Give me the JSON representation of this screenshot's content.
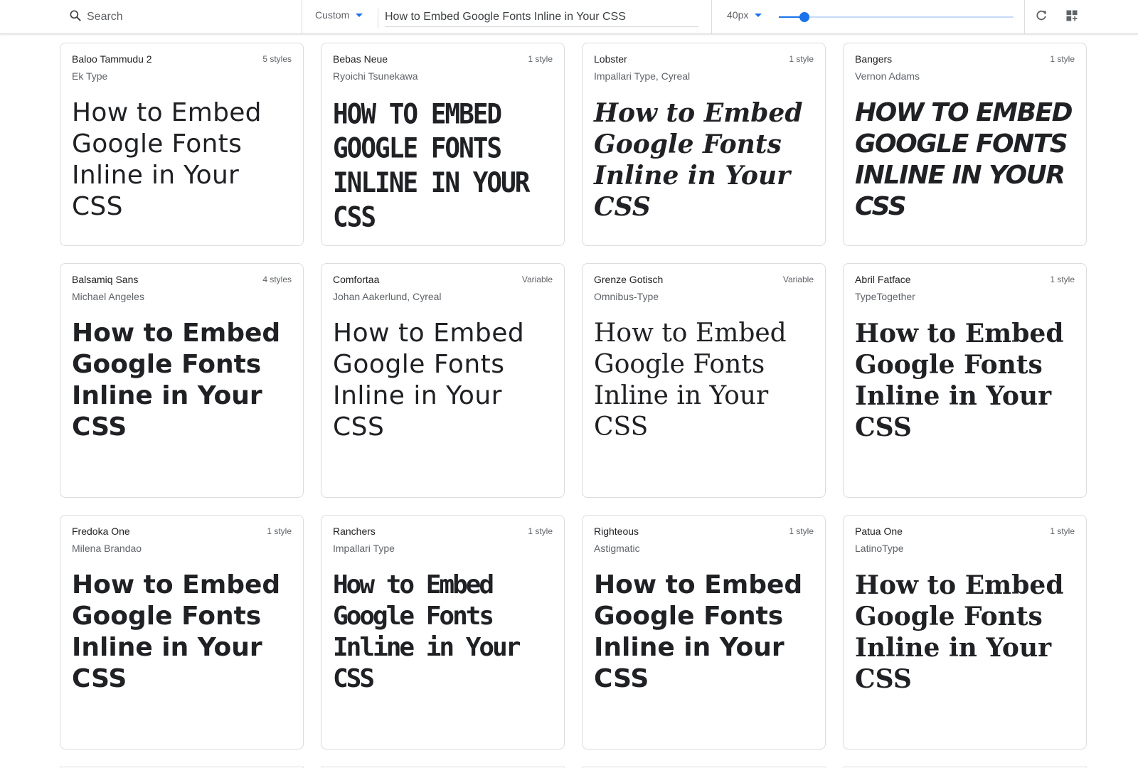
{
  "toolbar": {
    "search_placeholder": "Search",
    "category": "Custom",
    "preview_text": "How to Embed Google Fonts Inline in Your CSS",
    "font_size": "40px",
    "font_size_value": 40,
    "font_size_range": [
      8,
      300
    ]
  },
  "cards": [
    {
      "name": "Baloo Tammudu 2",
      "styles": "5 styles",
      "designer": "Ek Type",
      "sample": "How to Embed Google Fonts Inline in Your CSS"
    },
    {
      "name": "Bebas Neue",
      "styles": "1 style",
      "designer": "Ryoichi Tsunekawa",
      "sample": "How to Embed Google Fonts Inline in Your CSS"
    },
    {
      "name": "Lobster",
      "styles": "1 style",
      "designer": "Impallari Type, Cyreal",
      "sample": "How to Embed Google Fonts Inline in Your CSS"
    },
    {
      "name": "Bangers",
      "styles": "1 style",
      "designer": "Vernon Adams",
      "sample": "How to Embed Google Fonts Inline in Your CSS"
    },
    {
      "name": "Balsamiq Sans",
      "styles": "4 styles",
      "designer": "Michael Angeles",
      "sample": "How to Embed Google Fonts Inline in Your CSS"
    },
    {
      "name": "Comfortaa",
      "styles": "Variable",
      "designer": "Johan Aakerlund, Cyreal",
      "sample": "How to Embed Google Fonts Inline in Your CSS"
    },
    {
      "name": "Grenze Gotisch",
      "styles": "Variable",
      "designer": "Omnibus-Type",
      "sample": "How to Embed Google Fonts Inline in Your CSS"
    },
    {
      "name": "Abril Fatface",
      "styles": "1 style",
      "designer": "TypeTogether",
      "sample": "How to Embed Google Fonts Inline in Your CSS"
    },
    {
      "name": "Fredoka One",
      "styles": "1 style",
      "designer": "Milena Brandao",
      "sample": "How to Embed Google Fonts Inline in Your CSS"
    },
    {
      "name": "Ranchers",
      "styles": "1 style",
      "designer": "Impallari Type",
      "sample": "How to Embed Google Fonts Inline in Your CSS"
    },
    {
      "name": "Righteous",
      "styles": "1 style",
      "designer": "Astigmatic",
      "sample": "How to Embed Google Fonts Inline in Your CSS"
    },
    {
      "name": "Patua One",
      "styles": "1 style",
      "designer": "LatinoType",
      "sample": "How to Embed Google Fonts Inline in Your CSS"
    }
  ],
  "icons": {
    "search": "search-icon",
    "category_caret": "caret-down-icon",
    "size_caret": "caret-down-icon",
    "reset": "refresh-icon",
    "layout": "grid-view-icon"
  },
  "colors": {
    "accent": "#1a73e8",
    "border": "#dadce0",
    "text": "#202124",
    "muted": "#5f6368"
  }
}
